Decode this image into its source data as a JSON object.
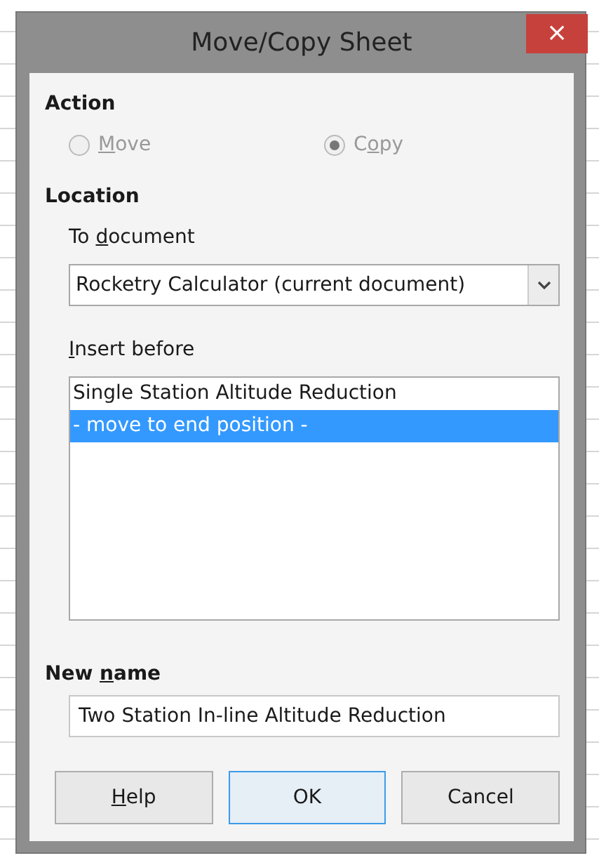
{
  "window": {
    "title": "Move/Copy Sheet",
    "close": "×"
  },
  "action": {
    "heading": "Action",
    "options": [
      {
        "key": "M",
        "post": "ove",
        "selected": false,
        "disabled": true
      },
      {
        "pre": "C",
        "key": "o",
        "post": "py",
        "selected": true,
        "disabled": true
      }
    ]
  },
  "location": {
    "heading": "Location",
    "to_document": {
      "label": {
        "pre": "To ",
        "key": "d",
        "post": "ocument"
      },
      "value": "Rocketry Calculator (current document)"
    },
    "insert_before": {
      "label": {
        "key": "I",
        "post": "nsert before"
      },
      "items": [
        {
          "text": "Single Station Altitude Reduction",
          "selected": false
        },
        {
          "text": "- move to end position -",
          "selected": true
        }
      ]
    }
  },
  "new_name": {
    "label": {
      "pre": "New ",
      "key": "n",
      "post": "ame"
    },
    "value": "Two Station In-line Altitude Reduction"
  },
  "buttons": [
    {
      "key": "H",
      "post": "elp",
      "default": false
    },
    {
      "pre": "OK",
      "default": true
    },
    {
      "pre": "Cancel",
      "default": false
    }
  ]
}
